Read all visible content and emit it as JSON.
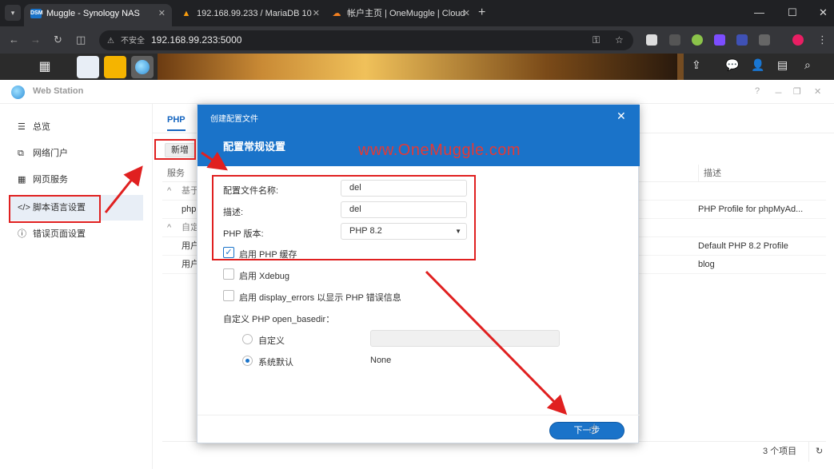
{
  "browser": {
    "tabs": [
      {
        "title": "Muggle - Synology NAS",
        "favicon": "DSM",
        "active": true
      },
      {
        "title": "192.168.99.233 / MariaDB 10",
        "favicon": "phpmyadmin-icon",
        "active": false
      },
      {
        "title": "帐户主页 | OneMuggle | Cloud",
        "favicon": "cloudflare-icon",
        "active": false
      }
    ],
    "insecure_label": "不安全",
    "url": "192.168.99.233:5000"
  },
  "window": {
    "title": "Web Station",
    "controls": [
      "?",
      "－",
      "❐",
      "✕"
    ]
  },
  "sidebar": {
    "items": [
      {
        "label": "总览",
        "icon": "list-icon"
      },
      {
        "label": "网络门户",
        "icon": "portal-icon"
      },
      {
        "label": "网页服务",
        "icon": "grid-icon"
      },
      {
        "label": "脚本语言设置",
        "icon": "code-icon",
        "selected": true
      },
      {
        "label": "错误页面设置",
        "icon": "alert-icon"
      }
    ]
  },
  "main": {
    "tab": "PHP",
    "add_button": "新增",
    "columns": {
      "service": "服务",
      "description": "描述"
    },
    "rows": [
      {
        "col1": "基于",
        "col2": "",
        "group": true
      },
      {
        "col1": "php",
        "col2": "PHP Profile for phpMyAd..."
      },
      {
        "col1": "自定",
        "col2": "",
        "group": true
      },
      {
        "col1": "用户",
        "col2": "Default PHP 8.2 Profile"
      },
      {
        "col1": "用户",
        "col2": "blog"
      }
    ],
    "footer_count": "3 个项目"
  },
  "modal": {
    "window_title": "创建配置文件",
    "heading": "配置常规设置",
    "watermark": "www.OneMuggle.com",
    "fields": {
      "name_label": "配置文件名称:",
      "name_value": "del",
      "desc_label": "描述:",
      "desc_value": "del",
      "version_label": "PHP 版本:",
      "version_value": "PHP 8.2"
    },
    "checkboxes": [
      {
        "label": "启用 PHP 缓存",
        "checked": true
      },
      {
        "label": "启用 Xdebug",
        "checked": false
      },
      {
        "label": "启用 display_errors 以显示 PHP 错误信息",
        "checked": false
      }
    ],
    "basedir_label": "自定义 PHP open_basedir：",
    "radios": [
      {
        "label": "自定义",
        "checked": false
      },
      {
        "label": "系统默认",
        "checked": true
      }
    ],
    "default_value": "None",
    "next_button": "下一步"
  },
  "colors": {
    "accent": "#1a73c9",
    "annotation": "#e02020"
  }
}
